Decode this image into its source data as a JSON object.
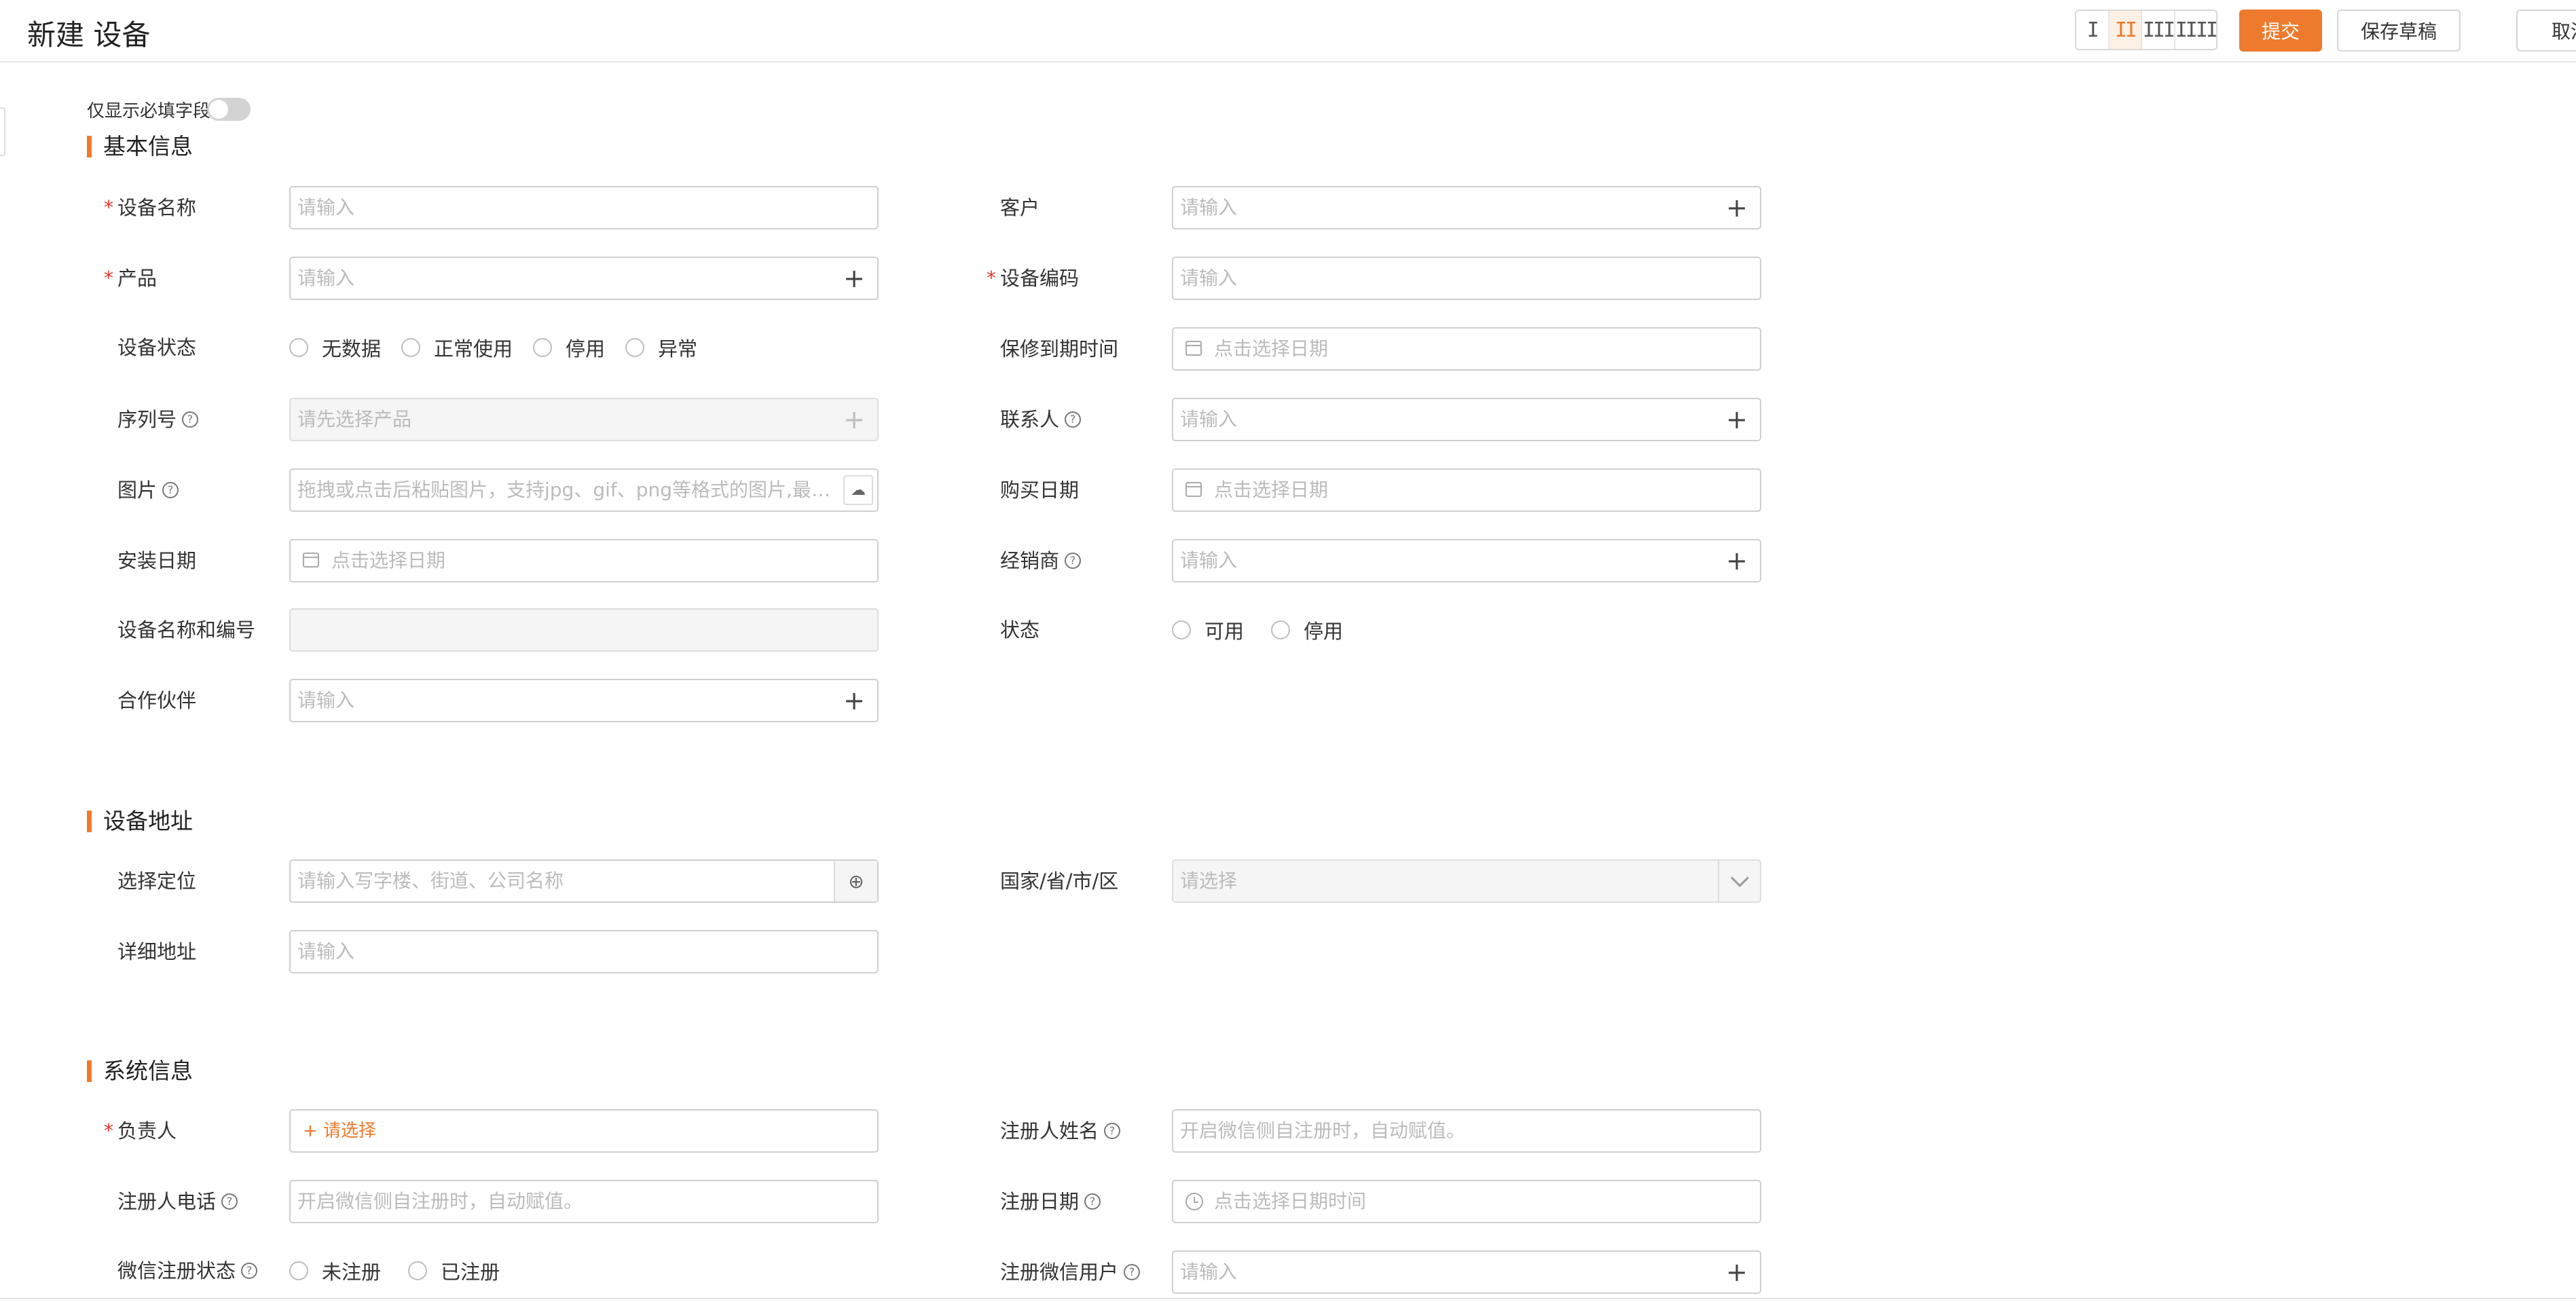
{
  "header": {
    "title": "新建 设备",
    "layout_options": [
      "I",
      "II",
      "III",
      "IIII"
    ],
    "active_layout": "II",
    "submit_label": "提交",
    "save_draft_label": "保存草稿",
    "cancel_label": "取消"
  },
  "filter": {
    "only_required_label": "仅显示必填字段",
    "only_required_on": false
  },
  "sections": {
    "basic": {
      "title": "基本信息",
      "device_name": {
        "label": "设备名称",
        "placeholder": "请输入",
        "required": true
      },
      "customer": {
        "label": "客户",
        "placeholder": "请输入"
      },
      "product": {
        "label": "产品",
        "placeholder": "请输入",
        "required": true
      },
      "device_code": {
        "label": "设备编码",
        "placeholder": "请输入",
        "required": true
      },
      "device_status": {
        "label": "设备状态",
        "options": [
          "无数据",
          "正常使用",
          "停用",
          "异常"
        ]
      },
      "warranty_expiry": {
        "label": "保修到期时间",
        "placeholder": "点击选择日期"
      },
      "serial_no": {
        "label": "序列号",
        "placeholder": "请先选择产品"
      },
      "contact": {
        "label": "联系人",
        "placeholder": "请输入"
      },
      "image": {
        "label": "图片",
        "placeholder": "拖拽或点击后粘贴图片，支持jpg、gif、png等格式的图片,最多..."
      },
      "purchase_date": {
        "label": "购买日期",
        "placeholder": "点击选择日期"
      },
      "install_date": {
        "label": "安装日期",
        "placeholder": "点击选择日期"
      },
      "dealer": {
        "label": "经销商",
        "placeholder": "请输入"
      },
      "name_and_code": {
        "label": "设备名称和编号"
      },
      "state": {
        "label": "状态",
        "options": [
          "可用",
          "停用"
        ]
      },
      "partner": {
        "label": "合作伙伴",
        "placeholder": "请输入"
      }
    },
    "address": {
      "title": "设备地址",
      "locate": {
        "label": "选择定位",
        "placeholder": "请输入写字楼、街道、公司名称"
      },
      "region": {
        "label": "国家/省/市/区",
        "placeholder": "请选择"
      },
      "detail": {
        "label": "详细地址",
        "placeholder": "请输入"
      }
    },
    "system": {
      "title": "系统信息",
      "owner": {
        "label": "负责人",
        "select_text": "+ 请选择",
        "required": true
      },
      "registrant_name": {
        "label": "注册人姓名",
        "placeholder": "开启微信侧自注册时，自动赋值。"
      },
      "registrant_phone": {
        "label": "注册人电话",
        "placeholder": "开启微信侧自注册时，自动赋值。"
      },
      "register_date": {
        "label": "注册日期",
        "placeholder": "点击选择日期时间"
      },
      "wechat_status": {
        "label": "微信注册状态",
        "options": [
          "未注册",
          "已注册"
        ]
      },
      "wechat_user": {
        "label": "注册微信用户",
        "placeholder": "请输入"
      }
    }
  },
  "colors": {
    "accent": "#ee7b2d",
    "required": "#e5382f",
    "border": "#cfcfcf"
  }
}
